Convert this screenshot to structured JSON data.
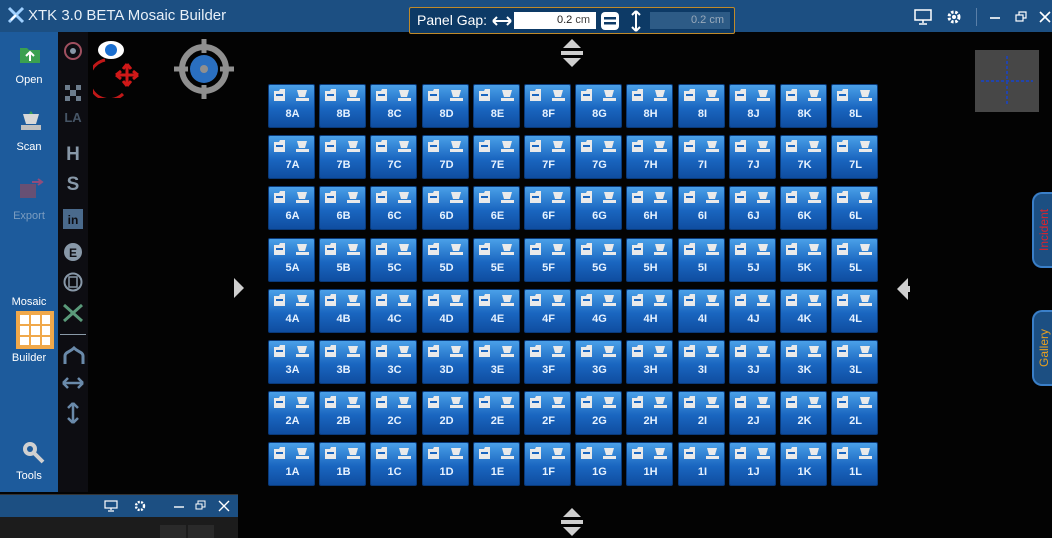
{
  "app": {
    "title": "XTK 3.0  BETA  Mosaic Builder"
  },
  "panel_gap": {
    "label": "Panel Gap:",
    "horizontal_value": "0.2",
    "vertical_value": "0.2",
    "unit": "cm"
  },
  "sidebar": {
    "open_label": "Open",
    "scan_label": "Scan",
    "export_label": "Export",
    "mosaic_label": "Mosaic",
    "builder_label": "Builder",
    "tools_label": "Tools"
  },
  "tabs": {
    "incident": "Incident",
    "gallery": "Gallery"
  },
  "grid": {
    "rows": [
      "8",
      "7",
      "6",
      "5",
      "4",
      "3",
      "2",
      "1"
    ],
    "cols": [
      "A",
      "B",
      "C",
      "D",
      "E",
      "F",
      "G",
      "H",
      "I",
      "J",
      "K",
      "L"
    ]
  },
  "colors": {
    "titlebar": "#1c4f82",
    "sidebar": "#1d5b9c",
    "tile": "#1a66c0",
    "accent": "#c08a2a",
    "incident_text": "#e0222a",
    "gallery_text": "#e8a020"
  }
}
